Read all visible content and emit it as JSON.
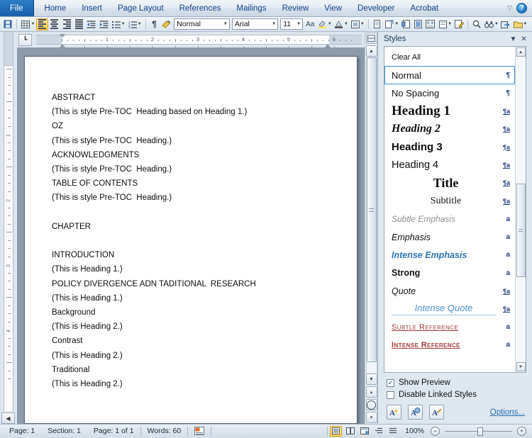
{
  "ribbon": {
    "file_tab": "File",
    "tabs": [
      "Home",
      "Insert",
      "Page Layout",
      "References",
      "Mailings",
      "Review",
      "View",
      "Developer",
      "Acrobat"
    ],
    "collapse_icon": "chevron-ribbon-icon",
    "help_icon": "?"
  },
  "toolbar": {
    "style_value": "Normal",
    "font_value": "Arial",
    "size_value": "11",
    "buttons": [
      {
        "name": "save-button",
        "glyph": "💾"
      },
      {
        "name": "table-button",
        "glyph": "▦"
      },
      {
        "name": "align-left-button",
        "glyph": "align-left"
      },
      {
        "name": "align-center-button",
        "glyph": "align-center"
      },
      {
        "name": "align-right-button",
        "glyph": "align-right"
      },
      {
        "name": "justify-button",
        "glyph": "justify"
      },
      {
        "name": "decrease-indent-button",
        "glyph": "⇤"
      },
      {
        "name": "increase-indent-button",
        "glyph": "⇥"
      },
      {
        "name": "bullet-list-button",
        "glyph": "☰"
      },
      {
        "name": "numbered-list-button",
        "glyph": "☷"
      },
      {
        "name": "show-formatting-marks-button",
        "glyph": "¶"
      },
      {
        "name": "format-painter-button",
        "glyph": "🖌"
      },
      {
        "name": "change-case-button",
        "glyph": "Aa"
      },
      {
        "name": "text-highlight-button",
        "glyph": "ab"
      },
      {
        "name": "font-color-button",
        "glyph": "A"
      },
      {
        "name": "picture-frame-button",
        "glyph": "⬚"
      },
      {
        "name": "page-setup-button",
        "glyph": "⌸"
      },
      {
        "name": "page-borders-button",
        "glyph": "❐"
      },
      {
        "name": "insert-table-button",
        "glyph": "▤"
      },
      {
        "name": "insert-note-button",
        "glyph": "▣"
      },
      {
        "name": "columns-button",
        "glyph": "▒"
      },
      {
        "name": "new-comment-button",
        "glyph": "▭"
      },
      {
        "name": "track-changes-button",
        "glyph": "✎"
      },
      {
        "name": "zoom-find-button",
        "glyph": "🔍"
      },
      {
        "name": "find-binoculars-button",
        "glyph": "ᴹᴹ"
      },
      {
        "name": "goto-button",
        "glyph": "⤷"
      },
      {
        "name": "folder-button",
        "glyph": "🗀"
      },
      {
        "name": "toolbar-overflow-button",
        "glyph": "≡"
      }
    ]
  },
  "ruler": {
    "tab_selector_glyph": "┗",
    "h_numbers": [
      "1",
      "2",
      "3",
      "4"
    ],
    "v_numbers": [
      "1",
      "2",
      "3",
      "4",
      "5"
    ]
  },
  "document": {
    "lines": [
      "ABSTRACT",
      "(This is style Pre-TOC  Heading based on Heading 1.)",
      "OZ",
      "(This is style Pre-TOC  Heading.)",
      "ACKNOWLEDGMENTS",
      "(This is style Pre-TOC  Heading.)",
      "TABLE OF CONTENTS",
      "(This is style Pre-TOC  Heading.)",
      "",
      "CHAPTER",
      "",
      "INTRODUCTION",
      "(This is Heading 1.)",
      "POLICY DIVERGENCE ADN TADITIONAL  RESEARCH",
      "(This is Heading 1.)",
      "Background",
      "(This is Heading 2.)",
      "Contrast",
      "(This is Heading 2.)",
      "Traditional",
      "(This is Heading 2.)"
    ]
  },
  "scrollbar": {
    "up_arrow": "▲",
    "down_arrow": "▼",
    "prev_page": "▴",
    "next_page": "▾",
    "browse_object": "select-browse-object"
  },
  "styles_pane": {
    "title": "Styles",
    "minimize_icon": "▼",
    "close_icon": "✕",
    "items": [
      {
        "label": "Clear All",
        "class": "st-clear",
        "mark": "",
        "mark_class": ""
      },
      {
        "label": "Normal",
        "class": "st-normal",
        "mark": "¶",
        "mark_class": "",
        "selected": true
      },
      {
        "label": "No Spacing",
        "class": "st-nospace",
        "mark": "¶",
        "mark_class": ""
      },
      {
        "label": "Heading 1",
        "class": "st-h1",
        "mark": "¶a",
        "mark_class": "aa"
      },
      {
        "label": "Heading 2",
        "class": "st-h2",
        "mark": "¶a",
        "mark_class": "aa"
      },
      {
        "label": "Heading 3",
        "class": "st-h3",
        "mark": "¶a",
        "mark_class": "aa"
      },
      {
        "label": "Heading 4",
        "class": "st-h4",
        "mark": "¶a",
        "mark_class": "aa"
      },
      {
        "label": "Title",
        "class": "st-title",
        "mark": "¶a",
        "mark_class": "aa"
      },
      {
        "label": "Subtitle",
        "class": "st-subtitle",
        "mark": "¶a",
        "mark_class": "aa"
      },
      {
        "label": "Subtle Emphasis",
        "class": "st-subtle-em",
        "mark": "a",
        "mark_class": ""
      },
      {
        "label": "Emphasis",
        "class": "st-em",
        "mark": "a",
        "mark_class": ""
      },
      {
        "label": "Intense Emphasis",
        "class": "st-intense-em",
        "mark": "a",
        "mark_class": ""
      },
      {
        "label": "Strong",
        "class": "st-strong",
        "mark": "a",
        "mark_class": ""
      },
      {
        "label": "Quote",
        "class": "st-quote",
        "mark": "¶a",
        "mark_class": "aa"
      },
      {
        "label": "Intense Quote",
        "class": "st-intense-quote",
        "mark": "¶a",
        "mark_class": "aa"
      },
      {
        "label": "Subtle Reference",
        "class": "st-sub-ref",
        "mark": "a",
        "mark_class": ""
      },
      {
        "label": "Intense Reference",
        "class": "st-int-ref",
        "mark": "a",
        "mark_class": ""
      }
    ],
    "show_preview_label": "Show Preview",
    "show_preview_checked": true,
    "disable_linked_label": "Disable Linked Styles",
    "disable_linked_checked": false,
    "buttons": [
      {
        "name": "new-style-button",
        "glyph": "A"
      },
      {
        "name": "style-inspector-button",
        "glyph": "A"
      },
      {
        "name": "manage-styles-button",
        "glyph": "A"
      }
    ],
    "options_label": "Options..."
  },
  "statusbar": {
    "page": "Page: 1",
    "section": "Section: 1",
    "page_of": "Page: 1 of 1",
    "words": "Words: 60",
    "proofing_icon": "proofing-errors-icon",
    "views": [
      {
        "name": "print-layout-view-button",
        "glyph": "▤",
        "active": true
      },
      {
        "name": "full-screen-reading-view-button",
        "glyph": "☷",
        "active": false
      },
      {
        "name": "web-layout-view-button",
        "glyph": "⬚",
        "active": false
      },
      {
        "name": "outline-view-button",
        "glyph": "≣",
        "active": false
      },
      {
        "name": "draft-view-button",
        "glyph": "≡",
        "active": false
      }
    ],
    "zoom_level": "100%",
    "zoom_out_glyph": "−",
    "zoom_in_glyph": "+"
  },
  "colors": {
    "accent_blue": "#1b5fa8",
    "highlight_gold": "#ffd24d",
    "selection_blue": "#3b8fd6",
    "link_blue": "#1f6fb5",
    "reference_red": "#a33b3b"
  }
}
